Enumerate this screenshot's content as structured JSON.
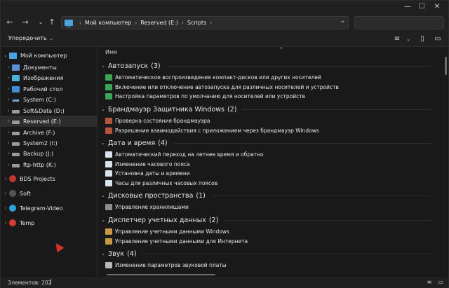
{
  "window": {
    "controls": {
      "minimize": "—",
      "maximize": "☐",
      "close": "✕"
    }
  },
  "nav": {
    "back": "←",
    "forward": "→",
    "recent": "⌄",
    "up": "↑",
    "breadcrumb": [
      "Мой компьютер",
      "Reserved (E:)",
      "Scripts"
    ],
    "address_dropdown": "⌄"
  },
  "commands": {
    "sort_label": "Упорядочить",
    "view_icon": "≡",
    "preview_icon": "▯",
    "details_icon": "▭"
  },
  "sidebar": {
    "root": {
      "label": "Мой компьютер",
      "icon": "computer-icon"
    },
    "items": [
      {
        "label": "Документы",
        "icon": "documents-icon"
      },
      {
        "label": "Изображения",
        "icon": "pictures-icon"
      },
      {
        "label": "Рабочий стол",
        "icon": "desktop-icon"
      },
      {
        "label": "System (C:)",
        "icon": "drive-icon"
      },
      {
        "label": "Soft&Data (D:)",
        "icon": "drive-icon"
      },
      {
        "label": "Reserved (E:)",
        "icon": "drive-icon",
        "selected": true
      },
      {
        "label": "Archive (F:)",
        "icon": "drive-icon"
      },
      {
        "label": "System2 (I:)",
        "icon": "drive-icon"
      },
      {
        "label": "Backup (J:)",
        "icon": "drive-icon"
      },
      {
        "label": "ftp-http (K:)",
        "icon": "drive-icon"
      }
    ],
    "pinned": [
      {
        "label": "BDS Projects",
        "icon": "bds-icon"
      },
      {
        "label": "Soft",
        "icon": "soft-icon"
      },
      {
        "label": "Telegram-Video",
        "icon": "telegram-icon"
      },
      {
        "label": "Temp",
        "icon": "temp-icon"
      }
    ]
  },
  "content": {
    "column_header": "Имя",
    "groups": [
      {
        "title": "Автозапуск",
        "count": "(3)",
        "icon": "autoplay-icon",
        "items": [
          "Автоматическое воспроизведение компакт-дисков или других носителей",
          "Включение или отключение автозапуска для различных носителей и устройств",
          "Настройка параметров по умолчанию для носителей или устройств"
        ]
      },
      {
        "title": "Брандмауэр Защитника Windows",
        "count": "(2)",
        "icon": "firewall-icon",
        "items": [
          "Проверка состояния брандмауэра",
          "Разрешение взаимодействия с приложением через брандмауэр Windows"
        ]
      },
      {
        "title": "Дата и время",
        "count": "(4)",
        "icon": "clock-icon",
        "items": [
          "Автоматический переход на летнее время и обратно",
          "Изменение часового пояса",
          "Установка даты и времени",
          "Часы для различных часовых поясов"
        ]
      },
      {
        "title": "Дисковые пространства",
        "count": "(1)",
        "icon": "storage-icon",
        "items": [
          "Управление хранилищами"
        ]
      },
      {
        "title": "Диспетчер учетных данных",
        "count": "(2)",
        "icon": "credentials-icon",
        "items": [
          "Управление учетными данными Windows",
          "Управление учетными данными для Интернета"
        ]
      },
      {
        "title": "Звук",
        "count": "(4)",
        "icon": "sound-icon",
        "items": [
          "Изменение параметров звуковой платы"
        ]
      }
    ]
  },
  "status": {
    "items_text": "Элементов: 202"
  }
}
